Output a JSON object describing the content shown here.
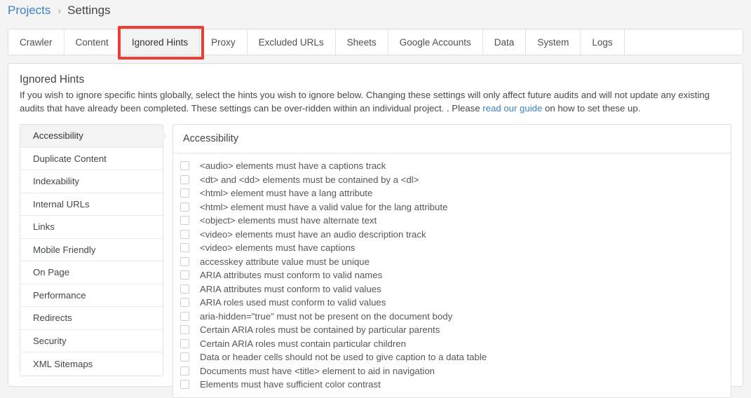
{
  "breadcrumb": {
    "link_label": "Projects",
    "separator": "›",
    "current_label": "Settings"
  },
  "colors": {
    "link": "#3c82c4",
    "annotation": "#ef3d35",
    "active_tab_bg": "#f3f3f3",
    "page_bg": "#f4f4f4"
  },
  "tabs": [
    {
      "label": "Crawler",
      "active": false
    },
    {
      "label": "Content",
      "active": false
    },
    {
      "label": "Ignored Hints",
      "active": true
    },
    {
      "label": "Proxy",
      "active": false
    },
    {
      "label": "Excluded URLs",
      "active": false
    },
    {
      "label": "Sheets",
      "active": false
    },
    {
      "label": "Google Accounts",
      "active": false
    },
    {
      "label": "Data",
      "active": false
    },
    {
      "label": "System",
      "active": false
    },
    {
      "label": "Logs",
      "active": false
    }
  ],
  "card": {
    "title": "Ignored Hints",
    "description_part1": "If you wish to ignore specific hints globally, select the hints you wish to ignore below. Changing these settings will only affect future audits and will not update any existing audits that have already been completed. These settings can be over-ridden within an individual project. . Please ",
    "description_link": "read our guide",
    "description_part2": " on how to set these up."
  },
  "categories": [
    {
      "label": "Accessibility",
      "active": true
    },
    {
      "label": "Duplicate Content",
      "active": false
    },
    {
      "label": "Indexability",
      "active": false
    },
    {
      "label": "Internal URLs",
      "active": false
    },
    {
      "label": "Links",
      "active": false
    },
    {
      "label": "Mobile Friendly",
      "active": false
    },
    {
      "label": "On Page",
      "active": false
    },
    {
      "label": "Performance",
      "active": false
    },
    {
      "label": "Redirects",
      "active": false
    },
    {
      "label": "Security",
      "active": false
    },
    {
      "label": "XML Sitemaps",
      "active": false
    }
  ],
  "panel": {
    "title": "Accessibility",
    "hints": [
      {
        "label": "<audio> elements must have a captions track",
        "checked": false
      },
      {
        "label": "<dt> and <dd> elements must be contained by a <dl>",
        "checked": false
      },
      {
        "label": "<html> element must have a lang attribute",
        "checked": false
      },
      {
        "label": "<html> element must have a valid value for the lang attribute",
        "checked": false
      },
      {
        "label": "<object> elements must have alternate text",
        "checked": false
      },
      {
        "label": "<video> elements must have an audio description track",
        "checked": false
      },
      {
        "label": "<video> elements must have captions",
        "checked": false
      },
      {
        "label": "accesskey attribute value must be unique",
        "checked": false
      },
      {
        "label": "ARIA attributes must conform to valid names",
        "checked": false
      },
      {
        "label": "ARIA attributes must conform to valid values",
        "checked": false
      },
      {
        "label": "ARIA roles used must conform to valid values",
        "checked": false
      },
      {
        "label": "aria-hidden=\"true\" must not be present on the document body",
        "checked": false
      },
      {
        "label": "Certain ARIA roles must be contained by particular parents",
        "checked": false
      },
      {
        "label": "Certain ARIA roles must contain particular children",
        "checked": false
      },
      {
        "label": "Data or header cells should not be used to give caption to a data table",
        "checked": false
      },
      {
        "label": "Documents must have <title> element to aid in navigation",
        "checked": false
      },
      {
        "label": "Elements must have sufficient color contrast",
        "checked": false
      }
    ]
  }
}
